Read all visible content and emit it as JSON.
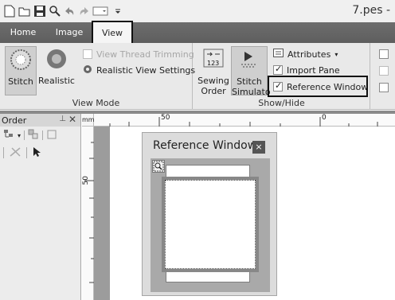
{
  "window": {
    "title": "7.pes -"
  },
  "tabs": {
    "home": "Home",
    "image": "Image",
    "view": "View"
  },
  "ribbon": {
    "view_mode": {
      "label": "View Mode",
      "stitch": "Stitch",
      "realistic": "Realistic",
      "view_thread_trimming": "View Thread Trimming",
      "realistic_view_settings": "Realistic View Settings"
    },
    "show_hide": {
      "label": "Show/Hide",
      "sewing_order": [
        "Sewing",
        "Order"
      ],
      "stitch_simulator": [
        "Stitch",
        "Simulato"
      ],
      "attributes": "Attributes",
      "import_pane": "Import Pane",
      "reference_window": "Reference Window"
    }
  },
  "pane": {
    "title": "Order"
  },
  "ruler": {
    "unit": "mm",
    "h_label_50": "50",
    "h_label_0": "0",
    "v_label": "50"
  },
  "reference_window": {
    "title": "Reference Window",
    "close": "×"
  }
}
